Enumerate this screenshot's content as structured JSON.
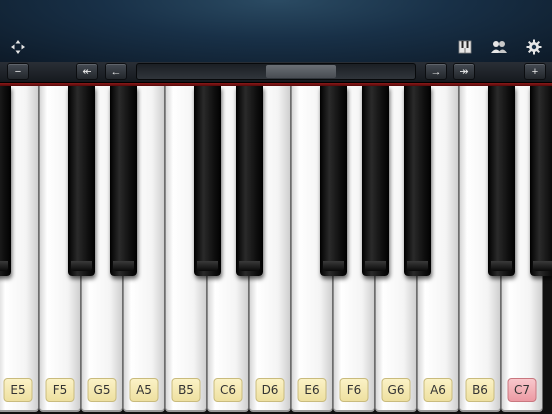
{
  "header": {
    "icons": {
      "left": "dpad-icon",
      "right": [
        "piano-keys-icon",
        "users-icon",
        "gear-icon"
      ]
    },
    "colors": {
      "header_bg": "#183047",
      "accent_red": "#8a1a1a"
    }
  },
  "toolbar": {
    "zoom_out_label": "−",
    "zoom_in_label": "+",
    "fast_left_label": "↞",
    "left_label": "←",
    "right_label": "→",
    "fast_right_label": "↠",
    "scroll_position": 0.62,
    "scroll_visible_fraction": 0.25
  },
  "keyboard": {
    "white_keys": [
      {
        "note": "E5"
      },
      {
        "note": "F5"
      },
      {
        "note": "G5"
      },
      {
        "note": "A5"
      },
      {
        "note": "B5"
      },
      {
        "note": "C6"
      },
      {
        "note": "D6"
      },
      {
        "note": "E6"
      },
      {
        "note": "F6"
      },
      {
        "note": "G6"
      },
      {
        "note": "A6"
      },
      {
        "note": "B6"
      },
      {
        "note": "C7",
        "active": true
      }
    ],
    "black_keys_after_white_index": [
      -1,
      1,
      2,
      4,
      5,
      7,
      8,
      9,
      11
    ],
    "label_color": "#f4e7ae",
    "active_label_color": "#f0a8b0"
  }
}
